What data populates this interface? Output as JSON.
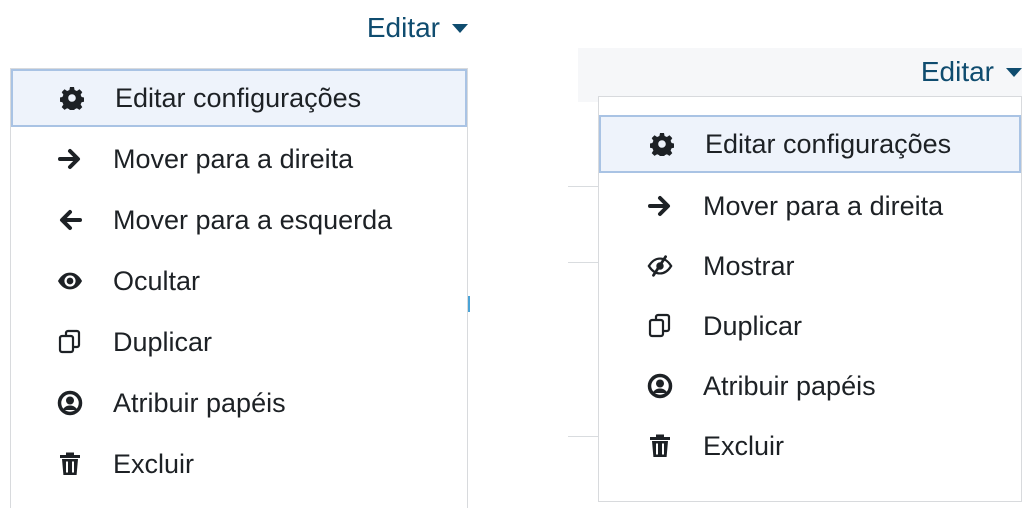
{
  "left_menu": {
    "trigger_label": "Editar",
    "items": [
      {
        "label": "Editar configurações",
        "icon": "gear-icon",
        "selected": true
      },
      {
        "label": "Mover para a direita",
        "icon": "arrow-right-icon"
      },
      {
        "label": "Mover para a esquerda",
        "icon": "arrow-left-icon"
      },
      {
        "label": "Ocultar",
        "icon": "eye-icon"
      },
      {
        "label": "Duplicar",
        "icon": "duplicate-icon"
      },
      {
        "label": "Atribuir papéis",
        "icon": "user-circle-icon"
      },
      {
        "label": "Excluir",
        "icon": "trash-icon"
      }
    ]
  },
  "right_menu": {
    "trigger_label": "Editar",
    "items": [
      {
        "label": "Editar configurações",
        "icon": "gear-icon",
        "selected": true
      },
      {
        "label": "Mover para a direita",
        "icon": "arrow-right-icon"
      },
      {
        "label": "Mostrar",
        "icon": "eye-slash-icon"
      },
      {
        "label": "Duplicar",
        "icon": "duplicate-icon"
      },
      {
        "label": "Atribuir papéis",
        "icon": "user-circle-icon"
      },
      {
        "label": "Excluir",
        "icon": "trash-icon"
      }
    ]
  },
  "colors": {
    "accent": "#0f4c6f",
    "selected_border": "#a9c3e4",
    "selected_bg": "#eef3fb"
  }
}
